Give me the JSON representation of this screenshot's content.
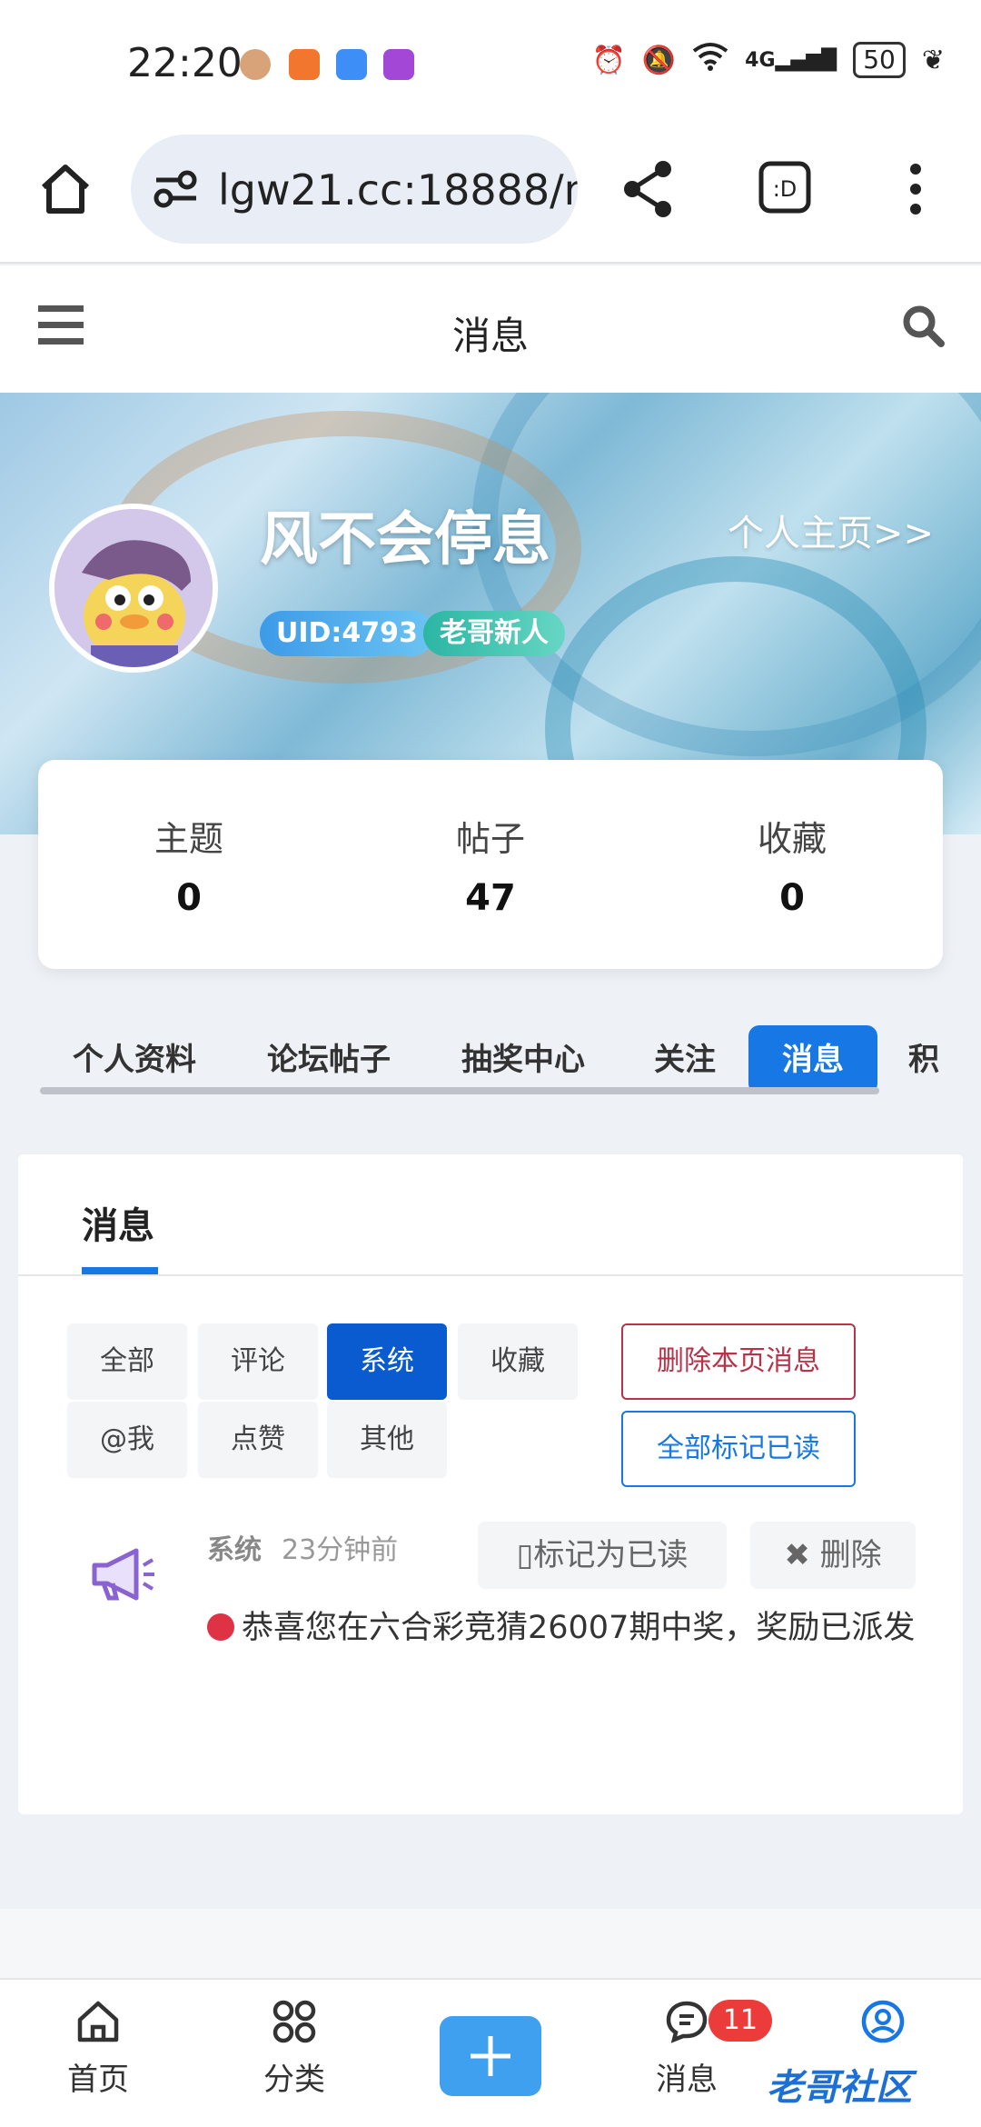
{
  "status_bar": {
    "time": "22:20",
    "battery": "50",
    "network": "4G"
  },
  "browser": {
    "url": "lgw21.cc:18888/m"
  },
  "header": {
    "title": "消息"
  },
  "profile": {
    "username": "风不会停息",
    "homepage_link": "个人主页>>",
    "uid": "UID:4793",
    "level": "老哥新人",
    "stats": [
      {
        "label": "主题",
        "value": "0"
      },
      {
        "label": "帖子",
        "value": "47"
      },
      {
        "label": "收藏",
        "value": "0"
      }
    ]
  },
  "profile_tabs": [
    "个人资料",
    "论坛帖子",
    "抽奖中心",
    "关注",
    "消息",
    "积"
  ],
  "messages": {
    "title": "消息",
    "filters": [
      "全部",
      "评论",
      "系统",
      "收藏",
      "@我",
      "点赞",
      "其他"
    ],
    "active_filter": "系统",
    "delete_page": "删除本页消息",
    "mark_all_read": "全部标记已读",
    "items": [
      {
        "type": "系统",
        "time": "23分钟前",
        "mark_read": "▯标记为已读",
        "delete": "删除",
        "body": "恭喜您在六合彩竞猜26007期中奖，奖励已派发"
      }
    ]
  },
  "bottom_nav": {
    "home": "首页",
    "category": "分类",
    "messages": "消息",
    "messages_badge": "11",
    "watermark": "老哥社区"
  },
  "colors": {
    "accent": "#1677e5",
    "danger": "#b8334a",
    "badge": "#ec3b3b"
  }
}
